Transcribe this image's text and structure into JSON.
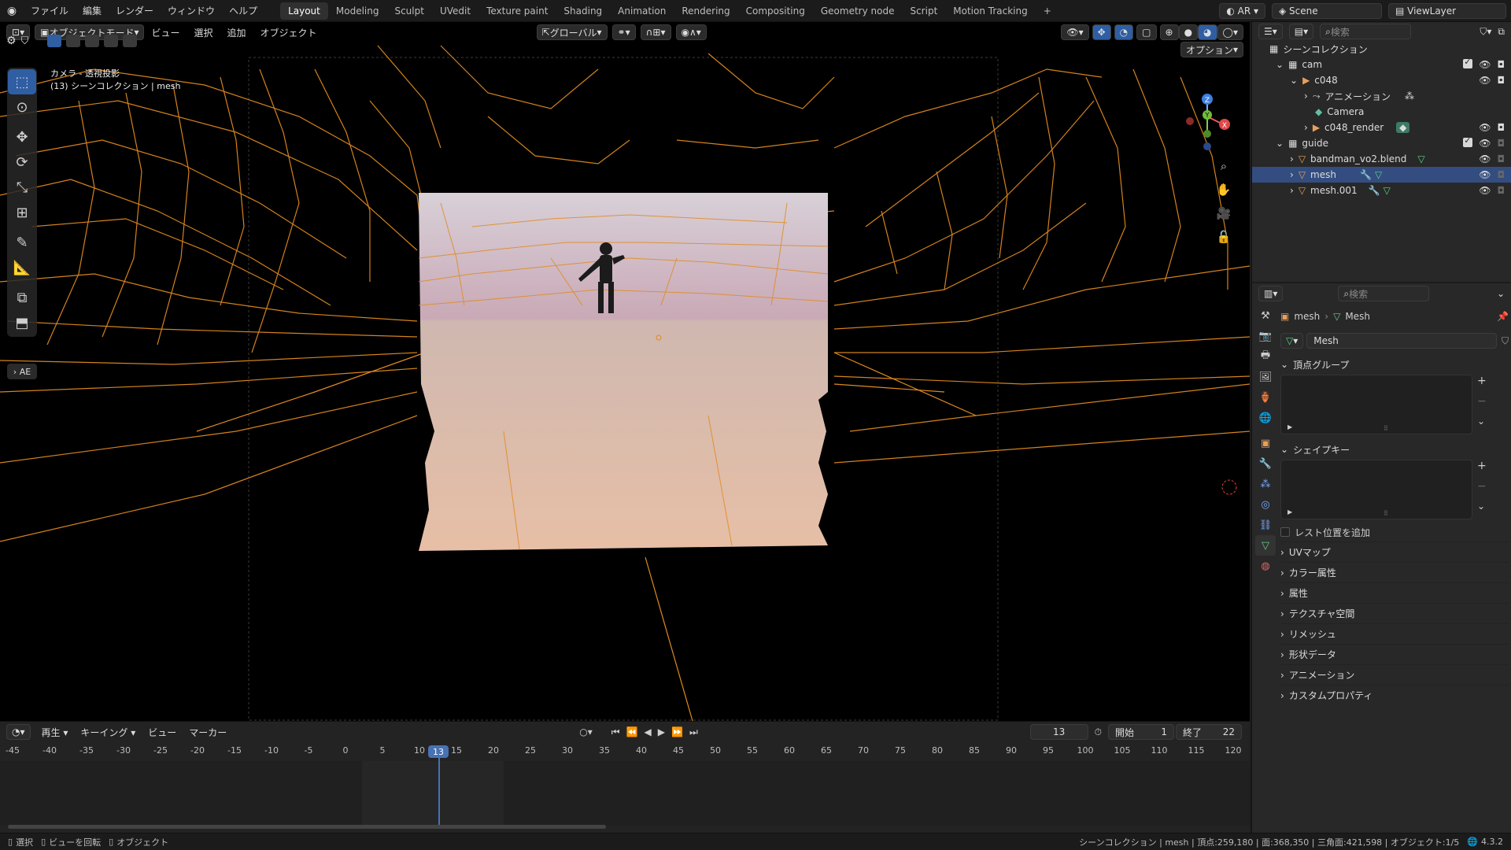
{
  "topbar": {
    "menus": [
      "ファイル",
      "編集",
      "レンダー",
      "ウィンドウ",
      "ヘルプ"
    ],
    "workspaces": [
      "Layout",
      "Modeling",
      "Sculpt",
      "UVedit",
      "Texture paint",
      "Shading",
      "Animation",
      "Rendering",
      "Compositing",
      "Geometry node",
      "Script",
      "Motion Tracking"
    ],
    "active_workspace": "Layout",
    "add_workspace": "+",
    "ar_label": "AR",
    "scene": "Scene",
    "view_layer": "ViewLayer"
  },
  "viewport": {
    "mode": "オブジェクトモード",
    "menus": [
      "ビュー",
      "選択",
      "追加",
      "オブジェクト"
    ],
    "transform_orientation": "グローバル",
    "options_label": "オプション",
    "overlay_line1": "カメラ - 透視投影",
    "overlay_line2": "(13) シーンコレクション | mesh",
    "ae_label": "AE",
    "gizmo_axes": [
      "X",
      "Y",
      "Z"
    ]
  },
  "outliner": {
    "search_placeholder": "検索",
    "root": "シーンコレクション",
    "rows": [
      {
        "label": "cam",
        "indent": 1,
        "icon": "collection-icon"
      },
      {
        "label": "c048",
        "indent": 2,
        "icon": "camera-object-icon"
      },
      {
        "label": "アニメーション",
        "indent": 3,
        "icon": "animation-icon"
      },
      {
        "label": "Camera",
        "indent": 3,
        "icon": "camera-data-icon"
      },
      {
        "label": "c048_render",
        "indent": 3,
        "icon": "camera-object-icon"
      },
      {
        "label": "guide",
        "indent": 1,
        "icon": "collection-icon"
      },
      {
        "label": "bandman_vo2.blend",
        "indent": 2,
        "icon": "mesh-icon"
      },
      {
        "label": "mesh",
        "indent": 2,
        "icon": "mesh-icon",
        "selected": true
      },
      {
        "label": "mesh.001",
        "indent": 2,
        "icon": "mesh-icon"
      }
    ]
  },
  "properties": {
    "search_placeholder": "検索",
    "breadcrumb_object": "mesh",
    "breadcrumb_data": "Mesh",
    "data_name": "Mesh",
    "vertex_groups": "頂点グループ",
    "shape_keys": "シェイプキー",
    "add_rest_position": "レスト位置を追加",
    "panels": [
      "UVマップ",
      "カラー属性",
      "属性",
      "テクスチャ空間",
      "リメッシュ",
      "形状データ",
      "アニメーション",
      "カスタムプロパティ"
    ]
  },
  "timeline": {
    "menus": [
      "再生",
      "キーイング",
      "ビュー",
      "マーカー"
    ],
    "current_frame": "13",
    "start_label": "開始",
    "start": "1",
    "end_label": "終了",
    "end": "22",
    "ticks": [
      "-45",
      "-40",
      "-35",
      "-30",
      "-25",
      "-20",
      "-15",
      "-10",
      "-5",
      "0",
      "5",
      "10",
      "15",
      "20",
      "25",
      "30",
      "35",
      "40",
      "45",
      "50",
      "55",
      "60",
      "65",
      "70",
      "75",
      "80",
      "85",
      "90",
      "95",
      "100",
      "105",
      "110",
      "115",
      "120"
    ],
    "playhead": "13"
  },
  "statusbar": {
    "select": "選択",
    "rotate": "ビューを回転",
    "object": "オブジェクト",
    "stats": "シーンコレクション | mesh | 頂点:259,180 | 面:368,350 | 三角面:421,598 | オブジェクト:1/5",
    "version": "4.3.2"
  },
  "colors": {
    "accent": "#4772b3",
    "wire": "#e08a1e",
    "selected_row": "#334d80"
  }
}
